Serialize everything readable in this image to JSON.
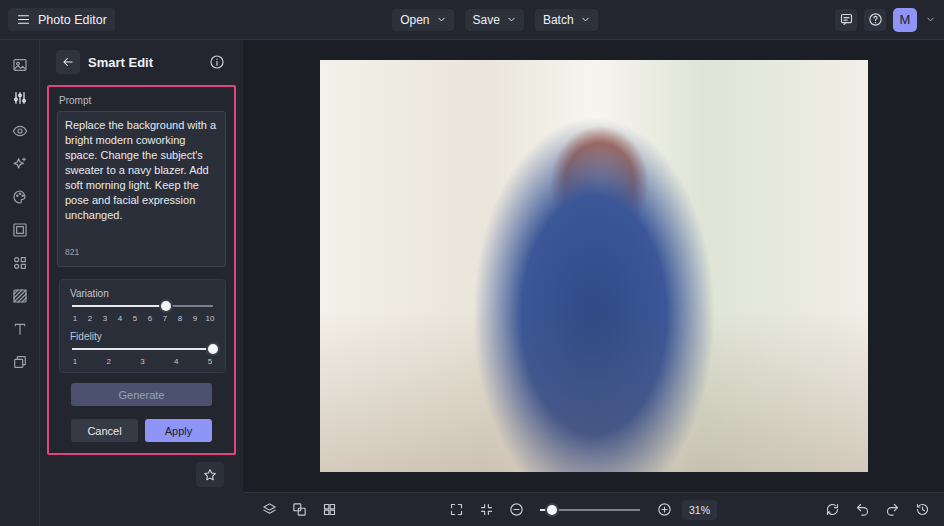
{
  "app": {
    "title": "Photo Editor"
  },
  "menus": [
    {
      "label": "Open"
    },
    {
      "label": "Save"
    },
    {
      "label": "Batch"
    }
  ],
  "user": {
    "initial": "M"
  },
  "rail": {
    "items": [
      {
        "selected": false
      },
      {
        "selected": true
      },
      {
        "selected": false
      },
      {
        "selected": false
      },
      {
        "selected": false
      },
      {
        "selected": false
      },
      {
        "selected": false
      },
      {
        "selected": false
      },
      {
        "selected": false
      },
      {
        "selected": false
      }
    ]
  },
  "panel": {
    "title": "Smart Edit",
    "prompt": {
      "label": "Prompt",
      "value": "Replace the background with a bright modern coworking space. Change the subject's sweater to a navy blazer. Add soft morning light. Keep the pose and facial expression unchanged.",
      "count": "821",
      "highlighted": true
    },
    "sliders": [
      {
        "label": "Variation",
        "level": 0.667,
        "ticks": [
          "1",
          "2",
          "3",
          "4",
          "5",
          "6",
          "7",
          "8",
          "9",
          "10"
        ]
      },
      {
        "label": "Fidelity",
        "level": 1,
        "ticks": [
          "1",
          "2",
          "3",
          "4",
          "5"
        ]
      }
    ],
    "generate": {
      "label": "Generate",
      "disabled": true
    },
    "actions": [
      {
        "label": "Cancel",
        "kind": "secondary"
      },
      {
        "label": "Apply",
        "kind": "primary"
      }
    ]
  },
  "canvas": {
    "zoom": {
      "level": 0.12,
      "reading": "31%"
    }
  }
}
